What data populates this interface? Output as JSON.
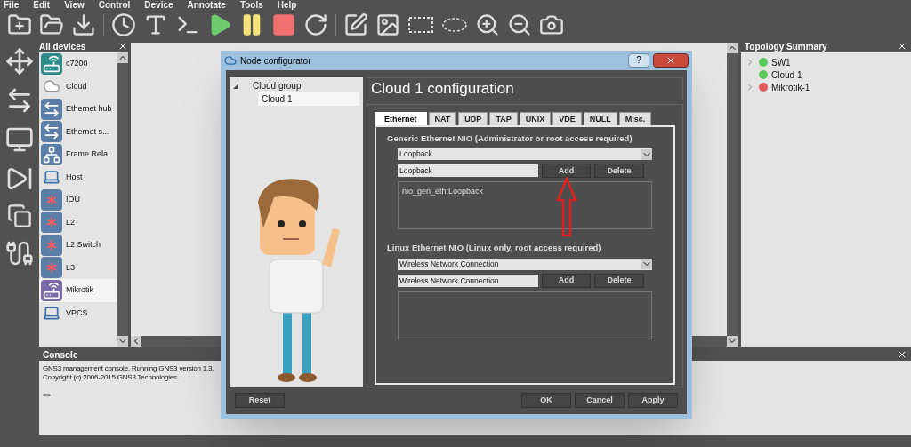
{
  "menu": [
    "File",
    "Edit",
    "View",
    "Control",
    "Device",
    "Annotate",
    "Tools",
    "Help"
  ],
  "devices_panel": {
    "title": "All devices",
    "items": [
      {
        "label": "c7200",
        "kind": "router",
        "selected": false
      },
      {
        "label": "Cloud",
        "kind": "cloud",
        "selected": false
      },
      {
        "label": "Ethernet hub",
        "kind": "hub",
        "selected": false
      },
      {
        "label": "Ethernet s...",
        "kind": "switch",
        "selected": false
      },
      {
        "label": "Frame Rela...",
        "kind": "frame",
        "selected": false
      },
      {
        "label": "Host",
        "kind": "host",
        "selected": false
      },
      {
        "label": "IOU",
        "kind": "multilayer",
        "selected": false
      },
      {
        "label": "L2",
        "kind": "multilayer",
        "selected": false
      },
      {
        "label": "L2 Switch",
        "kind": "multilayer",
        "selected": false
      },
      {
        "label": "L3",
        "kind": "multilayer",
        "selected": false
      },
      {
        "label": "Mikrotik",
        "kind": "router2",
        "selected": true
      },
      {
        "label": "VPCS",
        "kind": "host",
        "selected": false
      }
    ]
  },
  "topology": {
    "title": "Topology Summary",
    "items": [
      {
        "label": "SW1",
        "expandable": true,
        "color": "#5cc85c"
      },
      {
        "label": "Cloud 1",
        "expandable": false,
        "color": "#5cc85c"
      },
      {
        "label": "Mikrotik-1",
        "expandable": true,
        "color": "#e85a5a"
      }
    ]
  },
  "console": {
    "title": "Console",
    "lines": [
      "GNS3 management console. Running GNS3 version 1.3.",
      "Copyright (c) 2006-2015 GNS3 Technologies.",
      "=>"
    ]
  },
  "dialog": {
    "title": "Node configurator",
    "help": "?",
    "tree": {
      "label": "Cloud group",
      "expanded": true,
      "children": [
        {
          "label": "Cloud 1",
          "selected": true
        }
      ]
    },
    "heading": "Cloud 1 configuration",
    "tabs": [
      {
        "label": "Ethernet",
        "selected": true
      },
      {
        "label": "NAT",
        "selected": false
      },
      {
        "label": "UDP",
        "selected": false
      },
      {
        "label": "TAP",
        "selected": false
      },
      {
        "label": "UNIX",
        "selected": false
      },
      {
        "label": "VDE",
        "selected": false
      },
      {
        "label": "NULL",
        "selected": false
      },
      {
        "label": "Misc.",
        "selected": false
      }
    ],
    "sections": [
      {
        "title": "Generic Ethernet NIO (Administrator or root access required)",
        "dropdown": "Loopback",
        "field": "Loopback",
        "add": "Add",
        "delete": "Delete",
        "list": [
          "nio_gen_eth:Loopback"
        ],
        "annotated": true
      },
      {
        "title": "Linux Ethernet NIO (Linux only, root access required)",
        "dropdown": "Wireless Network Connection",
        "field": "Wireless Network Connection",
        "add": "Add",
        "delete": "Delete",
        "annotated": false
      }
    ],
    "reset": "Reset",
    "buttons": [
      "OK",
      "Cancel",
      "Apply"
    ]
  }
}
